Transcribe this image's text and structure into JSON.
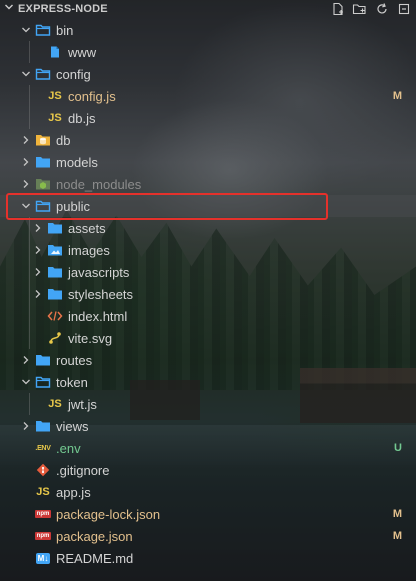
{
  "explorer": {
    "title": "EXPRESS-NODE",
    "header_chevron": "chevron-down",
    "actions": [
      "new-file",
      "new-folder",
      "refresh",
      "collapse-all"
    ]
  },
  "tree": [
    {
      "id": "bin",
      "label": "bin",
      "type": "folder",
      "open": true,
      "depth": 1,
      "icon": "folder-open-icon"
    },
    {
      "id": "www",
      "label": "www",
      "type": "file",
      "depth": 2,
      "icon": "file-icon"
    },
    {
      "id": "config",
      "label": "config",
      "type": "folder",
      "open": true,
      "depth": 1,
      "icon": "folder-open-icon"
    },
    {
      "id": "config-js",
      "label": "config.js",
      "type": "file",
      "depth": 2,
      "icon": "js-icon",
      "icon_text": "JS",
      "status": "M",
      "state": "modified"
    },
    {
      "id": "db-js",
      "label": "db.js",
      "type": "file",
      "depth": 2,
      "icon": "js-icon",
      "icon_text": "JS"
    },
    {
      "id": "db",
      "label": "db",
      "type": "folder",
      "open": false,
      "depth": 1,
      "icon": "database-folder-icon"
    },
    {
      "id": "models",
      "label": "models",
      "type": "folder",
      "open": false,
      "depth": 1,
      "icon": "folder-icon"
    },
    {
      "id": "node-modules",
      "label": "node_modules",
      "type": "folder",
      "open": false,
      "depth": 1,
      "icon": "node-folder-icon",
      "state": "ignored"
    },
    {
      "id": "public",
      "label": "public",
      "type": "folder",
      "open": true,
      "depth": 1,
      "icon": "folder-open-icon",
      "selected": true
    },
    {
      "id": "assets",
      "label": "assets",
      "type": "folder",
      "open": false,
      "depth": 2,
      "icon": "folder-icon"
    },
    {
      "id": "images",
      "label": "images",
      "type": "folder",
      "open": false,
      "depth": 2,
      "icon": "image-folder-icon"
    },
    {
      "id": "javascripts",
      "label": "javascripts",
      "type": "folder",
      "open": false,
      "depth": 2,
      "icon": "folder-icon"
    },
    {
      "id": "stylesheets",
      "label": "stylesheets",
      "type": "folder",
      "open": false,
      "depth": 2,
      "icon": "folder-icon"
    },
    {
      "id": "index-html",
      "label": "index.html",
      "type": "file",
      "depth": 2,
      "icon": "html-icon"
    },
    {
      "id": "vite-svg",
      "label": "vite.svg",
      "type": "file",
      "depth": 2,
      "icon": "svg-icon"
    },
    {
      "id": "routes",
      "label": "routes",
      "type": "folder",
      "open": false,
      "depth": 1,
      "icon": "routes-folder-icon"
    },
    {
      "id": "token",
      "label": "token",
      "type": "folder",
      "open": true,
      "depth": 1,
      "icon": "folder-open-icon"
    },
    {
      "id": "jwt-js",
      "label": "jwt.js",
      "type": "file",
      "depth": 2,
      "icon": "js-icon",
      "icon_text": "JS"
    },
    {
      "id": "views",
      "label": "views",
      "type": "folder",
      "open": false,
      "depth": 1,
      "icon": "folder-icon"
    },
    {
      "id": "env",
      "label": ".env",
      "type": "file",
      "depth": 1,
      "icon": "env-icon",
      "icon_text": ".ENV",
      "status": "U",
      "state": "untracked"
    },
    {
      "id": "gitignore",
      "label": ".gitignore",
      "type": "file",
      "depth": 1,
      "icon": "git-icon"
    },
    {
      "id": "app-js",
      "label": "app.js",
      "type": "file",
      "depth": 1,
      "icon": "js-icon",
      "icon_text": "JS"
    },
    {
      "id": "package-lock-json",
      "label": "package-lock.json",
      "type": "file",
      "depth": 1,
      "icon": "npm-icon",
      "icon_text": "npm",
      "status": "M",
      "state": "modified"
    },
    {
      "id": "package-json",
      "label": "package.json",
      "type": "file",
      "depth": 1,
      "icon": "npm-icon",
      "icon_text": "npm",
      "status": "M",
      "state": "modified"
    },
    {
      "id": "readme-md",
      "label": "README.md",
      "type": "file",
      "depth": 1,
      "icon": "markdown-icon",
      "icon_text": "M↓"
    }
  ],
  "colors": {
    "folder": "#42a5f5",
    "js": "#e8c84a",
    "modified": "#e2c08d",
    "untracked": "#73c991",
    "highlight_box": "#e5312b",
    "db_folder": "#f0b43c",
    "git": "#e55b3c",
    "vite": "#e8c84a"
  }
}
